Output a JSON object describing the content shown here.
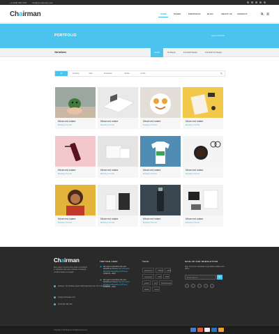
{
  "topbar": {
    "phone": "+1 (234) 566 7547",
    "email": "info@yourdomain.com"
  },
  "header": {
    "logo_pre": "Ch",
    "logo_accent": "a",
    "logo_post": "irman",
    "nav": [
      "HOME",
      "PAGES",
      "PORTFOLIO",
      "BLOG",
      "ABOUT US",
      "CONTACT"
    ],
    "active_nav": "HOME"
  },
  "banner": {
    "title": "PORTFOLIO",
    "breadcrumb": "Home / Portfolio"
  },
  "subbar": {
    "label": "Variations",
    "tabs": [
      "Simple",
      "No Margin",
      "Full Width Margin",
      "Full Width No Margin"
    ],
    "active_tab": "Simple"
  },
  "filters": {
    "items": [
      "All",
      "Desktop",
      "Web",
      "Illustration",
      "Media",
      "Crafts"
    ],
    "active": "All"
  },
  "portfolio": {
    "items": [
      {
        "title": "Mirum est notare",
        "meta": "Branding / Print Art"
      },
      {
        "title": "Mirum est notare",
        "meta": "Branding / Print Art"
      },
      {
        "title": "Mirum est notare",
        "meta": "Branding / Print Art"
      },
      {
        "title": "Mirum est notare",
        "meta": "Branding / Print Art"
      },
      {
        "title": "Mirum est notare",
        "meta": "Branding / Print Art"
      },
      {
        "title": "Mirum est notare",
        "meta": "Branding / Print Art"
      },
      {
        "title": "Mirum est notare",
        "meta": "Branding / Print Art"
      },
      {
        "title": "Mirum est notare",
        "meta": "Branding / Print Art"
      },
      {
        "title": "Mirum est notare",
        "meta": "Branding / Print Art"
      },
      {
        "title": "Mirum est notare",
        "meta": "Branding / Print Art"
      },
      {
        "title": "Mirum est notare",
        "meta": "Branding / Print Art"
      },
      {
        "title": "Mirum est notare",
        "meta": "Branding / Print Art"
      }
    ]
  },
  "footer": {
    "logo_pre": "Ch",
    "logo_accent": "a",
    "logo_post": "irman",
    "about": "Duis autem vel eum iriure dolor in hendrerit in vulputate velit esse molestie consequat, vel illum dolore eu feugiat.",
    "address": "Address : No 40 Baria Sreet 133/2 NewYork City, NY, United States",
    "email": "info@yourdomain.com",
    "phone": "(012) 800 456 789",
    "twitter_heading": "TWITTER FEED",
    "tweets": [
      {
        "text": "We want to introduce the new WordPress Theme ",
        "link": "Nalo #Creative #Portfolio #WordPress #Theme",
        "date": "JUNE 05 - 2016"
      },
      {
        "text": "We want to introduce the new WordPress Theme ",
        "link": "Nalo #Creative #Portfolio #WordPress #Theme",
        "date": "JUNE 05 - 2016"
      }
    ],
    "tags_heading": "TAGS",
    "tags": [
      "Wordpress",
      "HTML5",
      "CSS3",
      "responsive",
      "CSS",
      "PHP",
      "jordan",
      "site",
      "Retina Ready",
      "Mobile",
      "Green"
    ],
    "newsletter_heading": "SIGN UP FOR NEWSLETTER",
    "newsletter_text": "Sign up for our newsletter to get latest updates and offers.",
    "newsletter_placeholder": "Email address",
    "newsletter_button": "GO"
  },
  "bottombar": {
    "copyright": "Copyright © BootExperts All Rights Reserved"
  },
  "colors": {
    "accent": "#3cb7e5",
    "banner": "#4cc3ef",
    "footer_bg": "#2a2a2a"
  }
}
